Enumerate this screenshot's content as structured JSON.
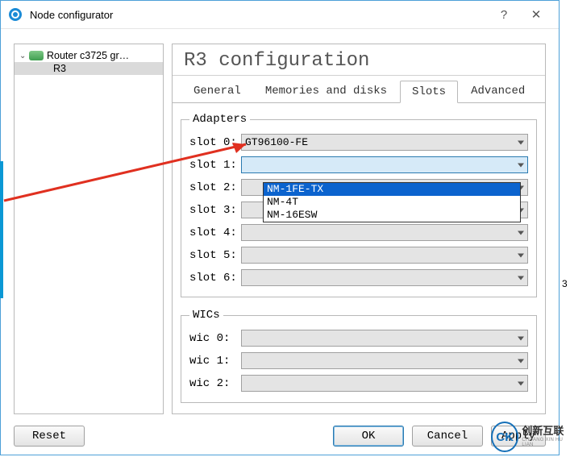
{
  "window": {
    "title": "Node configurator"
  },
  "tree": {
    "group": "Router c3725 gr…",
    "node": "R3"
  },
  "page": {
    "title": "R3 configuration"
  },
  "tabs": {
    "general": "General",
    "memories": "Memories and disks",
    "slots": "Slots",
    "advanced": "Advanced"
  },
  "adapters": {
    "legend": "Adapters",
    "slot0_label": "slot 0:",
    "slot0_value": "GT96100-FE",
    "slot1_label": "slot 1:",
    "slot1_value": "",
    "slot2_label": "slot 2:",
    "slot3_label": "slot 3:",
    "slot4_label": "slot 4:",
    "slot5_label": "slot 5:",
    "slot6_label": "slot 6:"
  },
  "wics": {
    "legend": "WICs",
    "wic0_label": "wic 0:",
    "wic1_label": "wic 1:",
    "wic2_label": "wic 2:"
  },
  "dropdown": {
    "opt1": "NM-1FE-TX",
    "opt2": "NM-4T",
    "opt3": "NM-16ESW"
  },
  "buttons": {
    "reset": "Reset",
    "ok": "OK",
    "cancel": "Cancel",
    "apply": "Apply"
  },
  "watermark": {
    "logo": "CK",
    "cn": "创新互联",
    "en": "CHUANG XIN HU LIAN"
  },
  "edge": {
    "r3": "3"
  }
}
